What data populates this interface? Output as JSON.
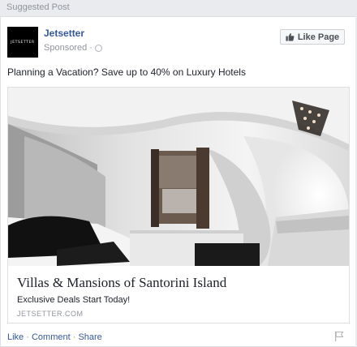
{
  "top_label": "Suggested Post",
  "post": {
    "page_name": "Jetsetter",
    "logo_text": "JETSETTER",
    "sponsored": "Sponsored",
    "sponsored_sep": "·",
    "like_page_label": "Like Page",
    "message": "Planning a Vacation? Save up to 40% on Luxury Hotels"
  },
  "ad": {
    "headline": "Villas & Mansions of Santorini Island",
    "description": "Exclusive Deals Start Today!",
    "domain": "JETSETTER.COM"
  },
  "actions": {
    "like": "Like",
    "comment": "Comment",
    "share": "Share",
    "separator": " · "
  },
  "icons": {
    "like_page": "thumbs-up-icon",
    "audience": "globe-icon",
    "report": "flag-icon"
  },
  "colors": {
    "link_blue": "#365899",
    "meta_gray": "#90949c",
    "text": "#1d2129"
  }
}
